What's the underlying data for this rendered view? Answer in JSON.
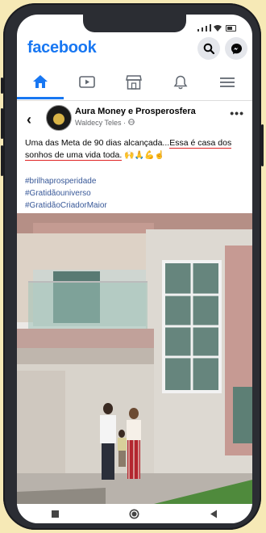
{
  "app": {
    "logo_text": "facebook"
  },
  "header": {
    "search_icon": "search-icon",
    "messenger_icon": "messenger-icon"
  },
  "tabs": [
    {
      "id": "home",
      "icon": "home-icon",
      "active": true
    },
    {
      "id": "watch",
      "icon": "video-icon",
      "active": false
    },
    {
      "id": "marketplace",
      "icon": "shop-icon",
      "active": false
    },
    {
      "id": "notifications",
      "icon": "bell-icon",
      "active": false
    },
    {
      "id": "menu",
      "icon": "menu-icon",
      "active": false
    }
  ],
  "post": {
    "page_name": "Aura Money e Prosperosfera",
    "author": "Waldecy Teles",
    "caption_part1": "Uma das Meta de 90 dias alcançada...",
    "caption_highlight_a": "Essa é casa dos",
    "caption_highlight_b": "sonhos de uma vida toda.",
    "caption_emojis": "🙌🙏💪☝",
    "hashtags": [
      "#brilhaprosperidade",
      "#Gratidãouniverso",
      "#GratidãoCriadorMaior"
    ]
  },
  "colors": {
    "brand": "#1877f2",
    "link": "#385898",
    "highlight_underline": "#e02424",
    "background": "#f6e9b6"
  }
}
